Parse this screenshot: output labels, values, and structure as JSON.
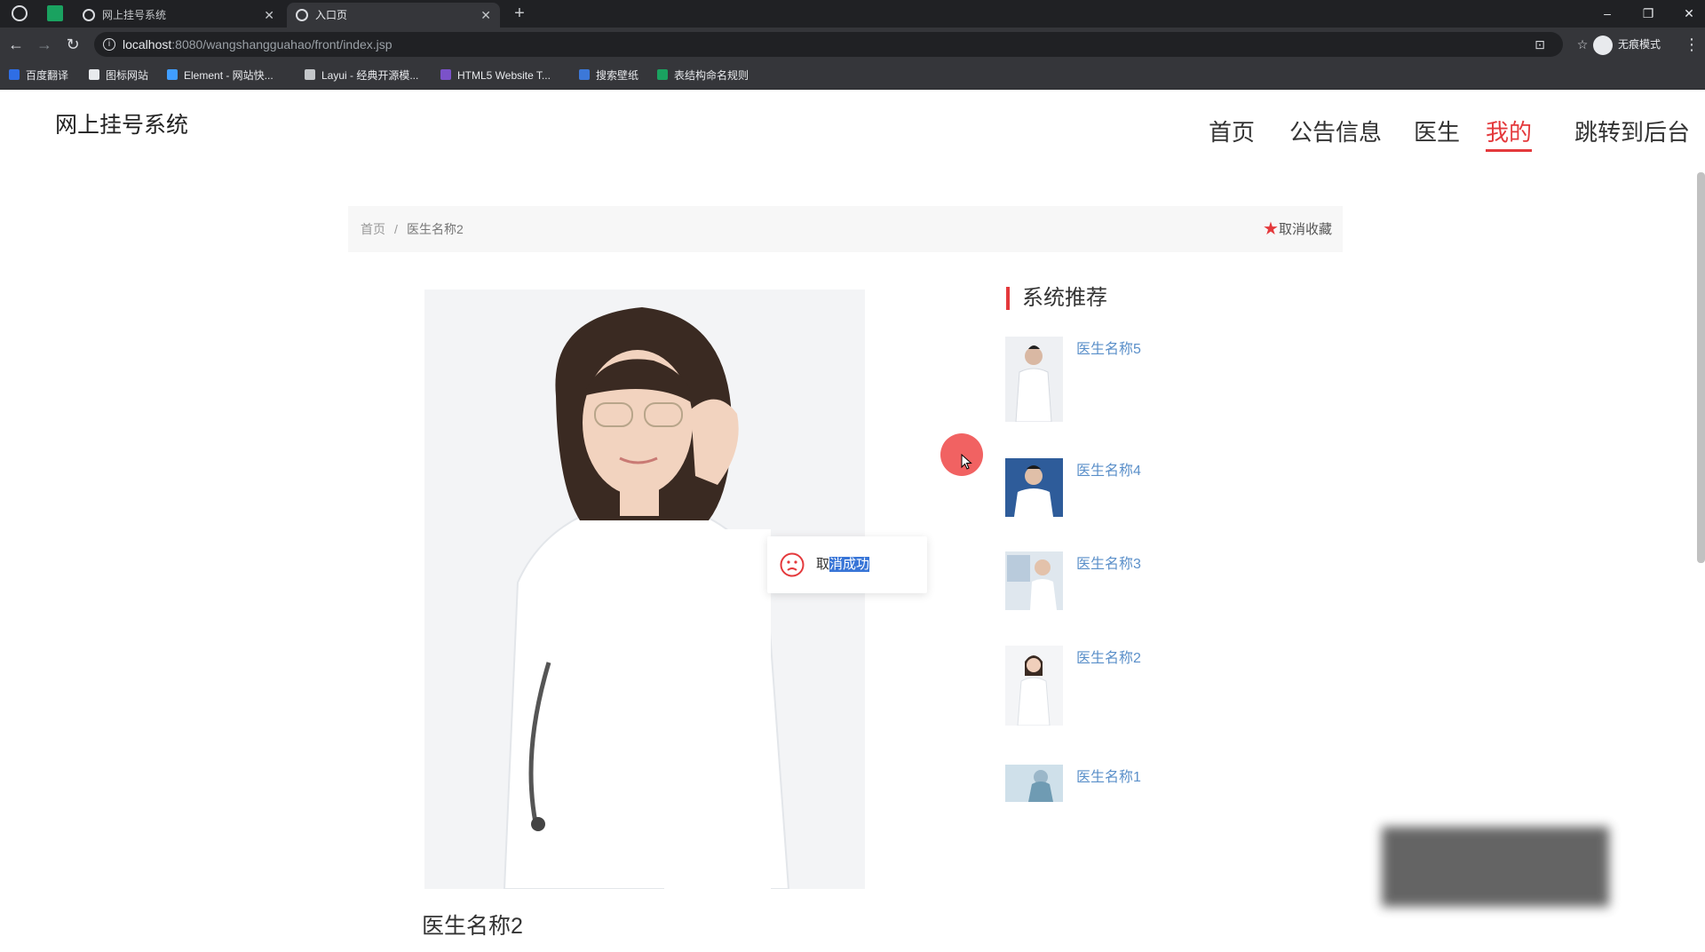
{
  "browser": {
    "tabs": [
      {
        "title": "网上挂号系统",
        "active": false
      },
      {
        "title": "入口页",
        "active": true
      }
    ],
    "url_host": "localhost",
    "url_path": ":8080/wangshangguahao/front/index.jsp",
    "incognito_label": "无痕模式",
    "bookmarks": [
      "百度翻译",
      "图标网站",
      "Element - 网站快...",
      "Layui - 经典开源模...",
      "HTML5 Website T...",
      "搜索壁纸",
      "表结构命名规则"
    ]
  },
  "header": {
    "brand": "网上挂号系统",
    "nav": [
      "首页",
      "公告信息",
      "医生",
      "我的",
      "跳转到后台"
    ],
    "active_nav": "我的"
  },
  "breadcrumb": {
    "home": "首页",
    "separator": "/",
    "current": "医生名称2",
    "favorite_label": "取消收藏"
  },
  "detail": {
    "doctor_name": "医生名称2"
  },
  "toast": {
    "prefix": "取",
    "selected": "消成功"
  },
  "recommend": {
    "title": "系统推荐",
    "items": [
      {
        "name": "医生名称5"
      },
      {
        "name": "医生名称4"
      },
      {
        "name": "医生名称3"
      },
      {
        "name": "医生名称2"
      },
      {
        "name": "医生名称1"
      }
    ]
  },
  "colors": {
    "accent": "#e4393c",
    "link": "#5a8fc9",
    "chrome_dark": "#202124",
    "chrome_bar": "#35363a"
  }
}
